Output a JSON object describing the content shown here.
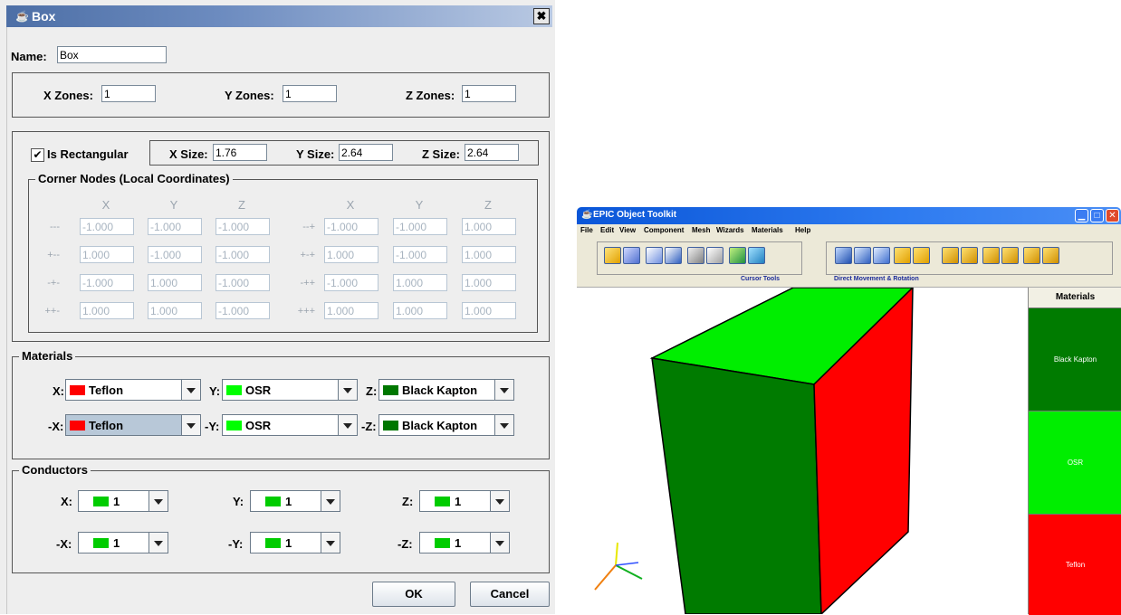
{
  "dialog": {
    "title": "Box",
    "close_glyph": "✖",
    "name_label": "Name:",
    "name_value": "Box",
    "zones": {
      "x_label": "X Zones:",
      "x_value": "1",
      "y_label": "Y Zones:",
      "y_value": "1",
      "z_label": "Z Zones:",
      "z_value": "1"
    },
    "size": {
      "rect_label": "Is Rectangular",
      "rect_checked": "✔",
      "x_label": "X Size:",
      "x_value": "1.76",
      "y_label": "Y Size:",
      "y_value": "2.64",
      "z_label": "Z Size:",
      "z_value": "2.64"
    },
    "corner_nodes": {
      "legend": "Corner Nodes (Local Coordinates)",
      "headers": [
        "X",
        "Y",
        "Z",
        "X",
        "Y",
        "Z"
      ],
      "left_rows": [
        {
          "label": "---",
          "x": "-1.000",
          "y": "-1.000",
          "z": "-1.000"
        },
        {
          "label": "+--",
          "x": "1.000",
          "y": "-1.000",
          "z": "-1.000"
        },
        {
          "label": "-+-",
          "x": "-1.000",
          "y": "1.000",
          "z": "-1.000"
        },
        {
          "label": "++-",
          "x": "1.000",
          "y": "1.000",
          "z": "-1.000"
        }
      ],
      "right_rows": [
        {
          "label": "--+",
          "x": "-1.000",
          "y": "-1.000",
          "z": "1.000"
        },
        {
          "label": "+-+",
          "x": "1.000",
          "y": "-1.000",
          "z": "1.000"
        },
        {
          "label": "-++",
          "x": "-1.000",
          "y": "1.000",
          "z": "1.000"
        },
        {
          "label": "+++",
          "x": "1.000",
          "y": "1.000",
          "z": "1.000"
        }
      ]
    },
    "materials": {
      "legend": "Materials",
      "x_label": "X:",
      "x_value": "Teflon",
      "y_label": "Y:",
      "y_value": "OSR",
      "z_label": "Z:",
      "z_value": "Black Kapton",
      "nx_label": "-X:",
      "nx_value": "Teflon",
      "ny_label": "-Y:",
      "ny_value": "OSR",
      "nz_label": "-Z:",
      "nz_value": "Black Kapton",
      "colors": {
        "Teflon": "#ff0000",
        "OSR": "#00ff00",
        "Black Kapton": "#007700"
      }
    },
    "conductors": {
      "legend": "Conductors",
      "x_label": "X:",
      "x_value": "1",
      "y_label": "Y:",
      "y_value": "1",
      "z_label": "Z:",
      "z_value": "1",
      "nx_label": "-X:",
      "nx_value": "1",
      "ny_label": "-Y:",
      "ny_value": "1",
      "nz_label": "-Z:",
      "nz_value": "1",
      "color": "#00cc00"
    },
    "ok_label": "OK",
    "cancel_label": "Cancel"
  },
  "app": {
    "title": "EPIC Object Toolkit",
    "menu": [
      "File",
      "Edit",
      "View",
      "Component",
      "Mesh",
      "Wizards",
      "Materials",
      "Help"
    ],
    "toolbar": {
      "cursor_caption": "Cursor Tools",
      "movement_caption": "Direct Movement & Rotation"
    },
    "materials_panel": {
      "header": "Materials",
      "items": [
        "Black Kapton",
        "OSR",
        "Teflon"
      ]
    }
  }
}
